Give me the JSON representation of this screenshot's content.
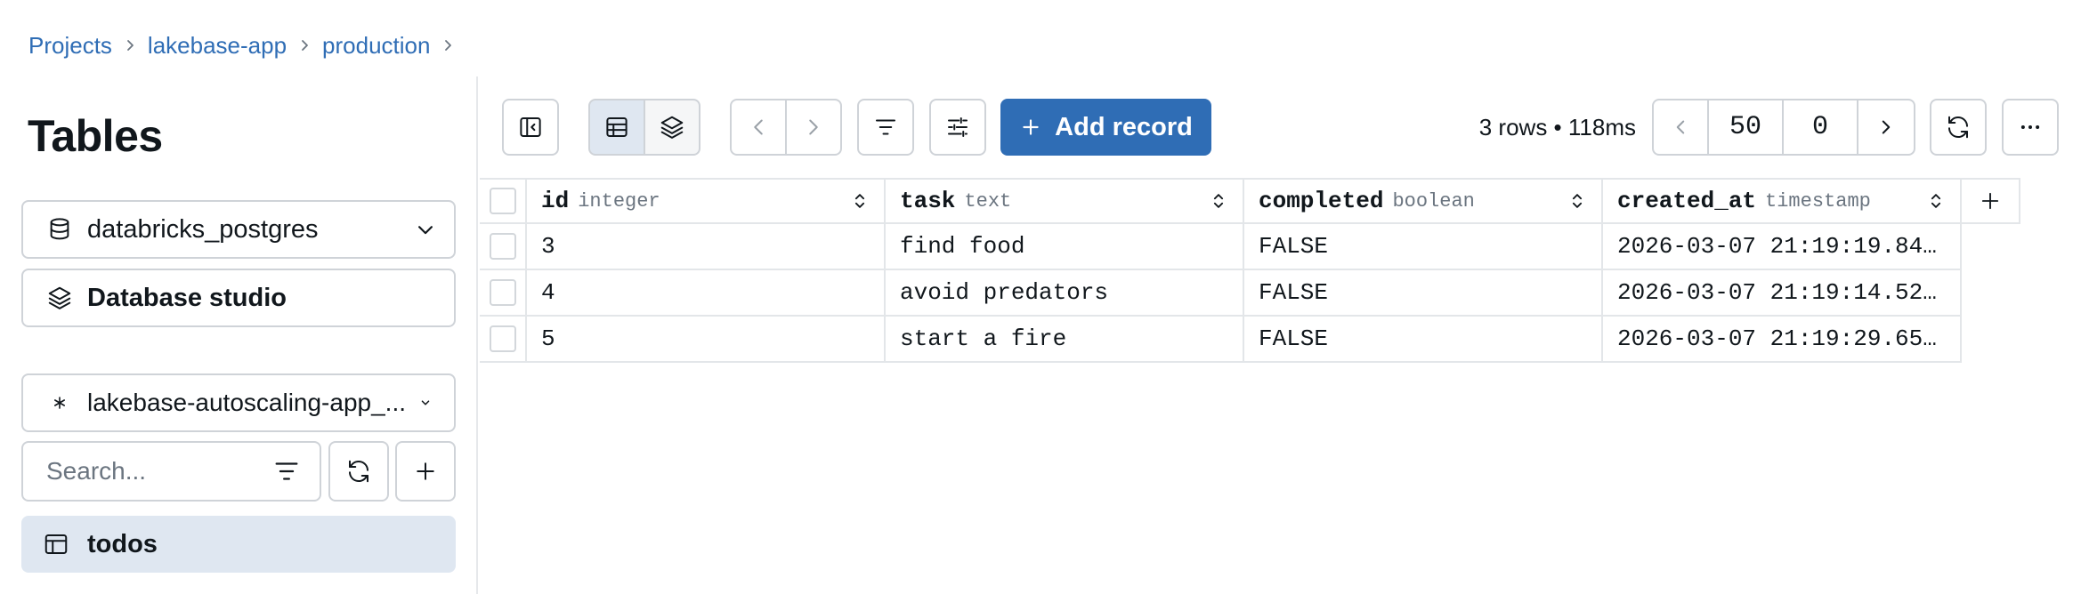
{
  "breadcrumb": [
    "Projects",
    "lakebase-app",
    "production"
  ],
  "sidebar": {
    "title": "Tables",
    "database": "databricks_postgres",
    "studio_label": "Database studio",
    "branch": "lakebase-autoscaling-app_...",
    "search_placeholder": "Search...",
    "tables": [
      "todos"
    ]
  },
  "toolbar": {
    "add_record_label": "Add record",
    "row_info": "3 rows • 118ms",
    "page_size": "50",
    "offset": "0"
  },
  "table": {
    "columns": [
      {
        "name": "id",
        "type": "integer"
      },
      {
        "name": "task",
        "type": "text"
      },
      {
        "name": "completed",
        "type": "boolean"
      },
      {
        "name": "created_at",
        "type": "timestamp"
      }
    ],
    "rows": [
      [
        "3",
        "find food",
        "FALSE",
        "2026-03-07 21:19:19.84…"
      ],
      [
        "4",
        "avoid predators",
        "FALSE",
        "2026-03-07 21:19:14.52…"
      ],
      [
        "5",
        "start a fire",
        "FALSE",
        "2026-03-07 21:19:29.65…"
      ]
    ]
  },
  "colors": {
    "accent": "#2f6db5",
    "selected_bg": "#dfe7f1",
    "border": "#cfd3d8"
  }
}
